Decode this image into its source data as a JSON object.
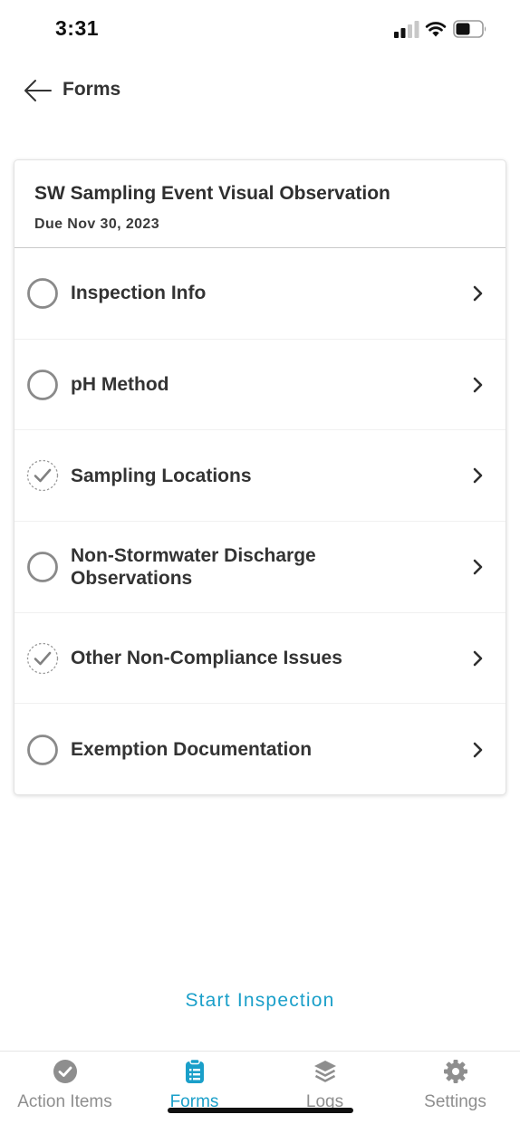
{
  "status_bar": {
    "time": "3:31",
    "icons": [
      "cellular-signal-icon",
      "wifi-icon",
      "battery-icon"
    ]
  },
  "header": {
    "back_icon": "arrow-left-icon",
    "title": "Forms"
  },
  "form": {
    "title": "SW Sampling Event Visual Observation",
    "due": "Due Nov 30, 2023",
    "sections": [
      {
        "label": "Inspection Info",
        "status": "incomplete"
      },
      {
        "label": "pH Method",
        "status": "incomplete"
      },
      {
        "label": "Sampling Locations",
        "status": "complete"
      },
      {
        "label": "Non-Stormwater Discharge Observations",
        "status": "incomplete"
      },
      {
        "label": "Other Non-Compliance Issues",
        "status": "complete"
      },
      {
        "label": "Exemption Documentation",
        "status": "incomplete"
      }
    ]
  },
  "actions": {
    "start_label": "Start Inspection"
  },
  "tabs": [
    {
      "label": "Action Items",
      "icon": "check-circle-icon",
      "active": false
    },
    {
      "label": "Forms",
      "icon": "clipboard-icon",
      "active": true
    },
    {
      "label": "Logs",
      "icon": "layers-icon",
      "active": false
    },
    {
      "label": "Settings",
      "icon": "gear-icon",
      "active": false
    }
  ],
  "colors": {
    "accent": "#1a9fc9",
    "text": "#333333",
    "inactive_tab": "#8e8e8e"
  }
}
